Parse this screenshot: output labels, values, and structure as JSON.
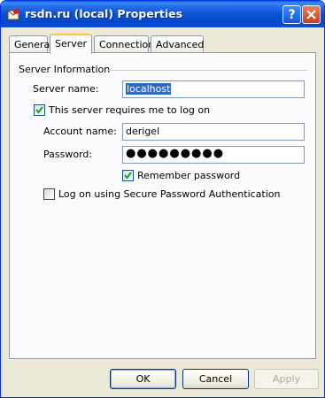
{
  "window": {
    "title": "rsdn.ru (local) Properties",
    "icons": [
      "app-icon",
      "help-icon",
      "close-icon"
    ]
  },
  "tabs": [
    {
      "label": "General",
      "active": false
    },
    {
      "label": "Server",
      "active": true
    },
    {
      "label": "Connection",
      "active": false
    },
    {
      "label": "Advanced",
      "active": false
    }
  ],
  "server_info": {
    "group_title": "Server Information",
    "server_name": {
      "label": "Server name:",
      "value": "localhost"
    },
    "requires_logon": {
      "label": "This server requires me to log on",
      "checked": true
    },
    "account_name": {
      "label": "Account name:",
      "value": "derigel"
    },
    "password": {
      "label": "Password:",
      "value": "●●●●●●●●●"
    },
    "remember_password": {
      "label": "Remember password",
      "checked": true
    },
    "spa": {
      "label": "Log on using Secure Password Authentication",
      "checked": false
    }
  },
  "buttons": {
    "ok": "OK",
    "cancel": "Cancel",
    "apply": "Apply"
  },
  "colors": {
    "title_bar": "#0a52d6",
    "active_tab_accent": "#ffc83c",
    "selection": "#316ac5",
    "checkmark": "#21a121"
  }
}
